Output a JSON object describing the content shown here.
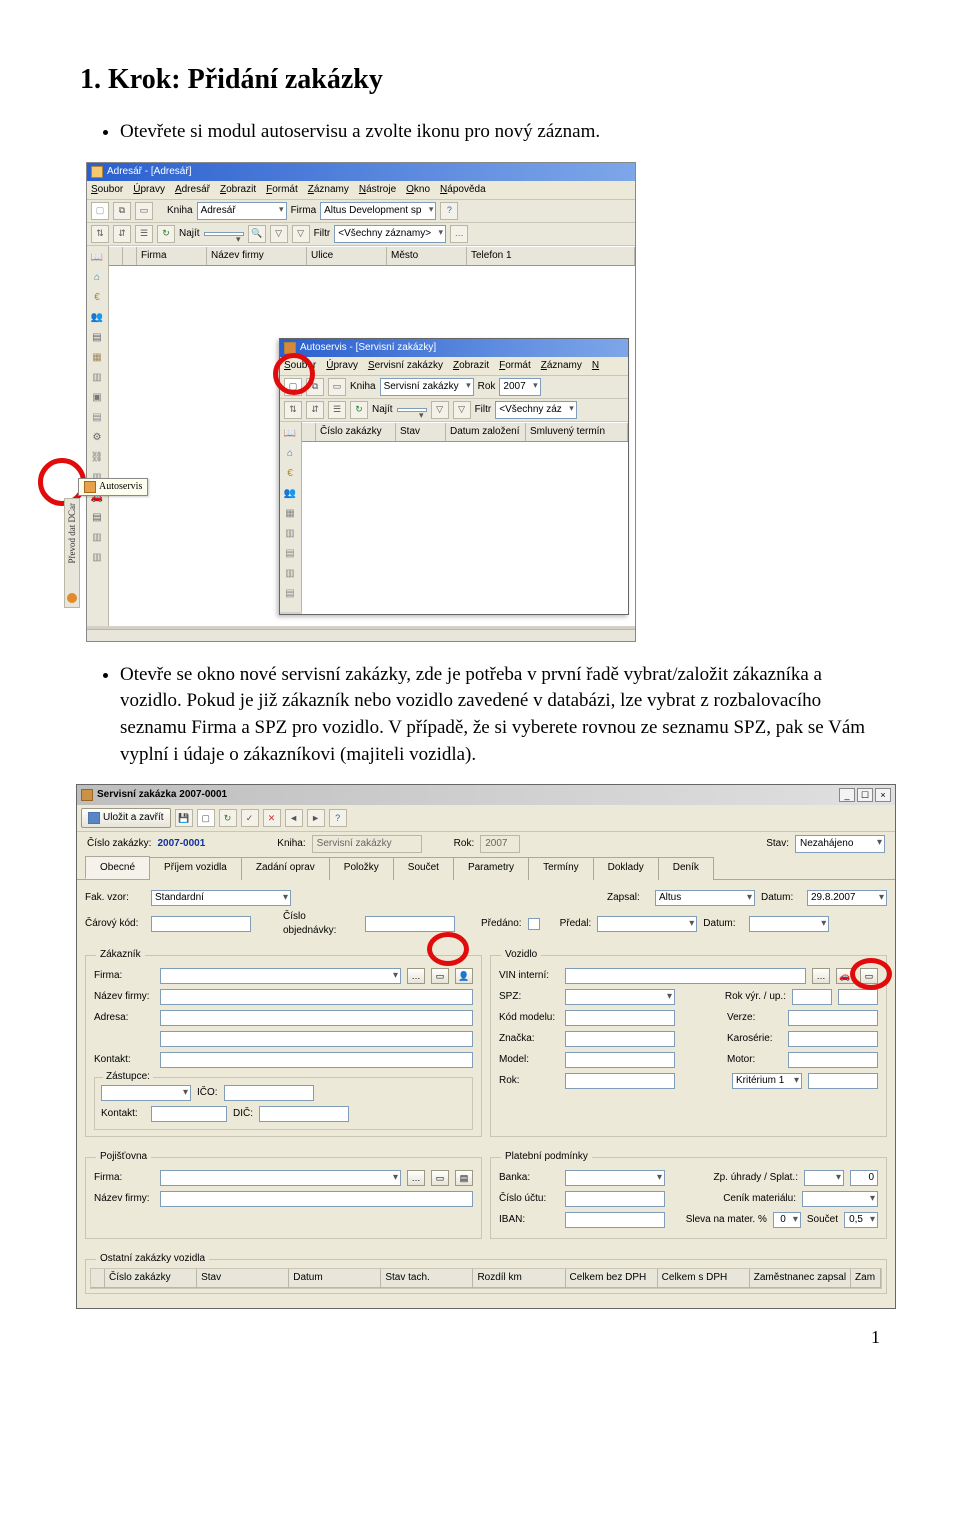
{
  "page_number": "1",
  "heading": "1. Krok: Přidání zakázky",
  "bullet1": "Otevřete si modul autoservisu a zvolte ikonu pro nový záznam.",
  "bullet2": "Otevře se okno nové servisní zakázky, zde je potřeba v první řadě vybrat/založit zákazníka a vozidlo. Pokud je již zákazník nebo vozidlo zavedené v databázi, lze vybrat z rozbalovacího seznamu Firma a SPZ pro vozidlo. V případě, že si vyberete rovnou ze seznamu SPZ, pak se Vám vyplní i údaje o zákazníkovi (majiteli vozidla).",
  "ss1": {
    "title": "Adresář - [Adresář]",
    "menu": [
      "Soubor",
      "Úpravy",
      "Adresář",
      "Zobrazit",
      "Formát",
      "Záznamy",
      "Nástroje",
      "Okno",
      "Nápověda"
    ],
    "tb1_kniha_label": "Kniha",
    "tb1_kniha_value": "Adresář",
    "tb1_firma_label": "Firma",
    "tb1_firma_value": "Altus Development sp",
    "tb2_najit": "Najít",
    "tb2_filtr_label": "Filtr",
    "tb2_filtr_value": "<Všechny záznamy>",
    "grid_cols": [
      "Firma",
      "Název firmy",
      "Ulice",
      "Město",
      "Telefon 1"
    ],
    "autoservis_tooltip": "Autoservis",
    "vertical_text": "Převod dat DCar"
  },
  "ss1_inner": {
    "title": "Autoservis - [Servisní zakázky]",
    "menu": [
      "Soubor",
      "Úpravy",
      "Servisní zakázky",
      "Zobrazit",
      "Formát",
      "Záznamy",
      "N"
    ],
    "tb_kniha_label": "Kniha",
    "tb_kniha_value": "Servisní zakázky",
    "tb_rok_label": "Rok",
    "tb_rok_value": "2007",
    "tb_najit": "Najít",
    "tb_filtr_label": "Filtr",
    "tb_filtr_value": "<Všechny záz",
    "grid_cols": [
      "Číslo zakázky",
      "Stav",
      "Datum založení",
      "Smluvený termín"
    ]
  },
  "ss2": {
    "title": "Servisní zakázka 2007-0001",
    "save_btn": "Uložit a zavřít",
    "row1": {
      "cislo_label": "Číslo zakázky:",
      "cislo_value": "2007-0001",
      "kniha_label": "Kniha:",
      "kniha_value": "Servisní zakázky",
      "rok_label": "Rok:",
      "rok_value": "2007",
      "stav_label": "Stav:",
      "stav_value": "Nezahájeno"
    },
    "tabs": [
      "Obecné",
      "Příjem vozidla",
      "Zadání oprav",
      "Položky",
      "Součet",
      "Parametry",
      "Termíny",
      "Doklady",
      "Deník"
    ],
    "row2": {
      "fak_label": "Fak. vzor:",
      "fak_value": "Standardní",
      "zapsal_label": "Zapsal:",
      "zapsal_value": "Altus",
      "datum1_label": "Datum:",
      "datum1_value": "29.8.2007",
      "carovy_label": "Čárový kód:",
      "cislo_obj_label": "Číslo objednávky:",
      "predano_label": "Předáno:",
      "predal_label": "Předal:",
      "datum2_label": "Datum:"
    },
    "zakaznik_legend": "Zákazník",
    "zak_firma": "Firma:",
    "zak_nazev": "Název firmy:",
    "zak_adresa": "Adresa:",
    "zak_kontakt": "Kontakt:",
    "zastupce_legend": "Zástupce:",
    "zas_kontakt": "Kontakt:",
    "zas_ico": "IČO:",
    "zas_dic": "DIČ:",
    "vozidlo_legend": "Vozidlo",
    "voz_vin": "VIN interní:",
    "voz_spz": "SPZ:",
    "voz_kod": "Kód modelu:",
    "voz_znacka": "Značka:",
    "voz_model": "Model:",
    "voz_rok": "Rok:",
    "voz_rokvyr": "Rok výr. / up.:",
    "voz_verze": "Verze:",
    "voz_karoserie": "Karosérie:",
    "voz_motor": "Motor:",
    "voz_krit": "Kritérium 1",
    "pojistovna_legend": "Pojišťovna",
    "poj_firma": "Firma:",
    "poj_nazev": "Název firmy:",
    "platebni_legend": "Platební podmínky",
    "pl_banka": "Banka:",
    "pl_cislo": "Číslo účtu:",
    "pl_iban": "IBAN:",
    "pl_zp": "Zp. úhrady / Splat.:",
    "pl_cenik": "Ceník materiálu:",
    "pl_sleva": "Sleva na mater. %",
    "pl_sleva_val": "0",
    "pl_soucet": "Součet",
    "pl_soucet_val": "0,5",
    "pl_splat_val": "0",
    "ostatni_legend": "Ostatní zakázky vozidla",
    "bg_cols": [
      "Číslo zakázky",
      "Stav",
      "Datum",
      "Stav tach.",
      "Rozdíl km",
      "Celkem bez DPH",
      "Celkem s DPH",
      "Zaměstnanec zapsal",
      "Zam"
    ]
  }
}
